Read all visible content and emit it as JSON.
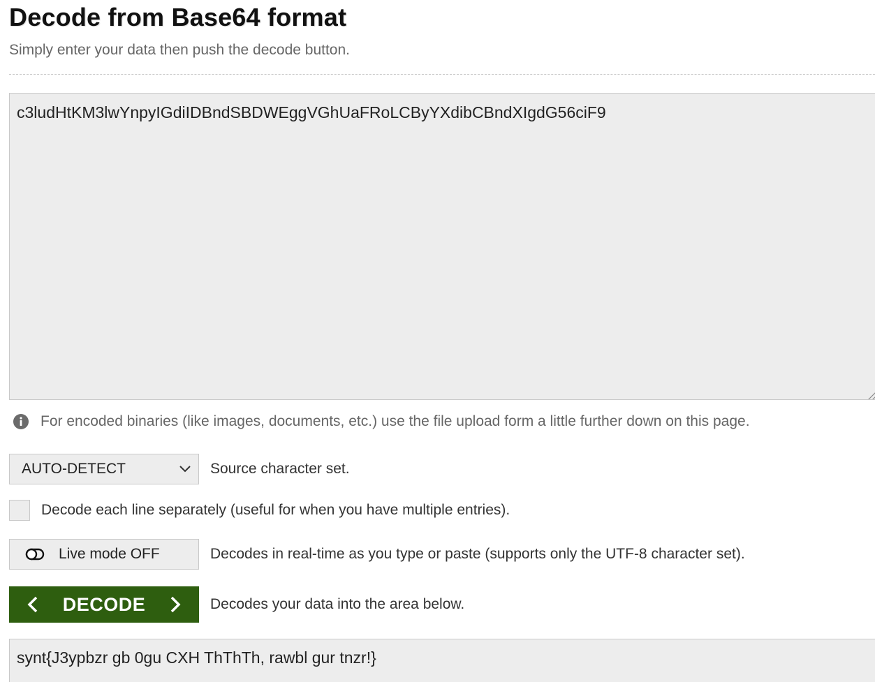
{
  "header": {
    "title": "Decode from Base64 format",
    "subtitle": "Simply enter your data then push the decode button."
  },
  "input": {
    "value": "c3ludHtKM3lwYnpyIGdiIDBndSBDWEggVGhUaFRoLCByYXdibCBndXIgdG56ciF9"
  },
  "info": {
    "text": "For encoded binaries (like images, documents, etc.) use the file upload form a little further down on this page."
  },
  "charset": {
    "selected": "AUTO-DETECT",
    "description": "Source character set."
  },
  "per_line": {
    "label": "Decode each line separately (useful for when you have multiple entries).",
    "checked": false
  },
  "live_mode": {
    "label": "Live mode OFF",
    "description": "Decodes in real-time as you type or paste (supports only the UTF-8 character set)."
  },
  "decode": {
    "label": "DECODE",
    "description": "Decodes your data into the area below.",
    "color": "#2e5e0f"
  },
  "output": {
    "value": "synt{J3ypbzr gb 0gu CXH ThThTh, rawbl gur tnzr!}"
  }
}
